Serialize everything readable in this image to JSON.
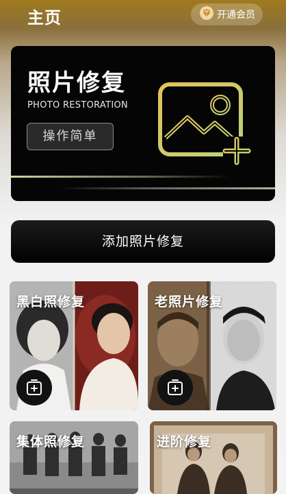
{
  "header": {
    "title": "主页",
    "vip_label": "开通会员"
  },
  "hero": {
    "title": "照片修复",
    "subtitle": "PHOTO RESTORATION",
    "tag": "操作简单"
  },
  "add_button": {
    "label": "添加照片修复"
  },
  "cards": [
    {
      "label": "黑白照修复"
    },
    {
      "label": "老照片修复"
    },
    {
      "label": "集体照修复"
    },
    {
      "label": "进阶修复"
    }
  ],
  "colors": {
    "gold": "#d6b54a",
    "accent_green": "#c7e08a",
    "dark": "#050505"
  },
  "icons": [
    "diamond-icon",
    "image-add-icon",
    "add-photo-icon"
  ]
}
